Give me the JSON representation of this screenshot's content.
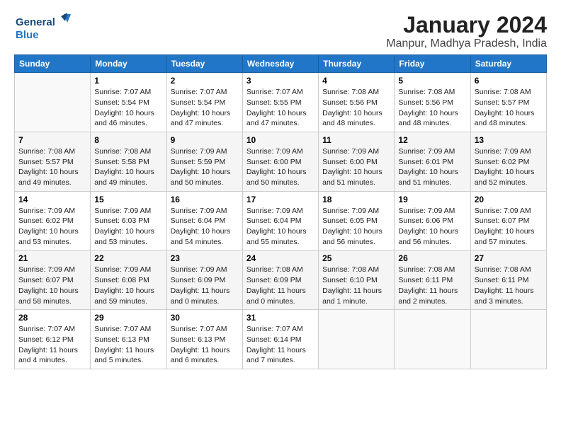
{
  "logo": {
    "line1": "General",
    "line2": "Blue"
  },
  "title": "January 2024",
  "subtitle": "Manpur, Madhya Pradesh, India",
  "days_header": [
    "Sunday",
    "Monday",
    "Tuesday",
    "Wednesday",
    "Thursday",
    "Friday",
    "Saturday"
  ],
  "weeks": [
    [
      {
        "day": "",
        "info": ""
      },
      {
        "day": "1",
        "info": "Sunrise: 7:07 AM\nSunset: 5:54 PM\nDaylight: 10 hours\nand 46 minutes."
      },
      {
        "day": "2",
        "info": "Sunrise: 7:07 AM\nSunset: 5:54 PM\nDaylight: 10 hours\nand 47 minutes."
      },
      {
        "day": "3",
        "info": "Sunrise: 7:07 AM\nSunset: 5:55 PM\nDaylight: 10 hours\nand 47 minutes."
      },
      {
        "day": "4",
        "info": "Sunrise: 7:08 AM\nSunset: 5:56 PM\nDaylight: 10 hours\nand 48 minutes."
      },
      {
        "day": "5",
        "info": "Sunrise: 7:08 AM\nSunset: 5:56 PM\nDaylight: 10 hours\nand 48 minutes."
      },
      {
        "day": "6",
        "info": "Sunrise: 7:08 AM\nSunset: 5:57 PM\nDaylight: 10 hours\nand 48 minutes."
      }
    ],
    [
      {
        "day": "7",
        "info": "Sunrise: 7:08 AM\nSunset: 5:57 PM\nDaylight: 10 hours\nand 49 minutes."
      },
      {
        "day": "8",
        "info": "Sunrise: 7:08 AM\nSunset: 5:58 PM\nDaylight: 10 hours\nand 49 minutes."
      },
      {
        "day": "9",
        "info": "Sunrise: 7:09 AM\nSunset: 5:59 PM\nDaylight: 10 hours\nand 50 minutes."
      },
      {
        "day": "10",
        "info": "Sunrise: 7:09 AM\nSunset: 6:00 PM\nDaylight: 10 hours\nand 50 minutes."
      },
      {
        "day": "11",
        "info": "Sunrise: 7:09 AM\nSunset: 6:00 PM\nDaylight: 10 hours\nand 51 minutes."
      },
      {
        "day": "12",
        "info": "Sunrise: 7:09 AM\nSunset: 6:01 PM\nDaylight: 10 hours\nand 51 minutes."
      },
      {
        "day": "13",
        "info": "Sunrise: 7:09 AM\nSunset: 6:02 PM\nDaylight: 10 hours\nand 52 minutes."
      }
    ],
    [
      {
        "day": "14",
        "info": "Sunrise: 7:09 AM\nSunset: 6:02 PM\nDaylight: 10 hours\nand 53 minutes."
      },
      {
        "day": "15",
        "info": "Sunrise: 7:09 AM\nSunset: 6:03 PM\nDaylight: 10 hours\nand 53 minutes."
      },
      {
        "day": "16",
        "info": "Sunrise: 7:09 AM\nSunset: 6:04 PM\nDaylight: 10 hours\nand 54 minutes."
      },
      {
        "day": "17",
        "info": "Sunrise: 7:09 AM\nSunset: 6:04 PM\nDaylight: 10 hours\nand 55 minutes."
      },
      {
        "day": "18",
        "info": "Sunrise: 7:09 AM\nSunset: 6:05 PM\nDaylight: 10 hours\nand 56 minutes."
      },
      {
        "day": "19",
        "info": "Sunrise: 7:09 AM\nSunset: 6:06 PM\nDaylight: 10 hours\nand 56 minutes."
      },
      {
        "day": "20",
        "info": "Sunrise: 7:09 AM\nSunset: 6:07 PM\nDaylight: 10 hours\nand 57 minutes."
      }
    ],
    [
      {
        "day": "21",
        "info": "Sunrise: 7:09 AM\nSunset: 6:07 PM\nDaylight: 10 hours\nand 58 minutes."
      },
      {
        "day": "22",
        "info": "Sunrise: 7:09 AM\nSunset: 6:08 PM\nDaylight: 10 hours\nand 59 minutes."
      },
      {
        "day": "23",
        "info": "Sunrise: 7:09 AM\nSunset: 6:09 PM\nDaylight: 11 hours\nand 0 minutes."
      },
      {
        "day": "24",
        "info": "Sunrise: 7:08 AM\nSunset: 6:09 PM\nDaylight: 11 hours\nand 0 minutes."
      },
      {
        "day": "25",
        "info": "Sunrise: 7:08 AM\nSunset: 6:10 PM\nDaylight: 11 hours\nand 1 minute."
      },
      {
        "day": "26",
        "info": "Sunrise: 7:08 AM\nSunset: 6:11 PM\nDaylight: 11 hours\nand 2 minutes."
      },
      {
        "day": "27",
        "info": "Sunrise: 7:08 AM\nSunset: 6:11 PM\nDaylight: 11 hours\nand 3 minutes."
      }
    ],
    [
      {
        "day": "28",
        "info": "Sunrise: 7:07 AM\nSunset: 6:12 PM\nDaylight: 11 hours\nand 4 minutes."
      },
      {
        "day": "29",
        "info": "Sunrise: 7:07 AM\nSunset: 6:13 PM\nDaylight: 11 hours\nand 5 minutes."
      },
      {
        "day": "30",
        "info": "Sunrise: 7:07 AM\nSunset: 6:13 PM\nDaylight: 11 hours\nand 6 minutes."
      },
      {
        "day": "31",
        "info": "Sunrise: 7:07 AM\nSunset: 6:14 PM\nDaylight: 11 hours\nand 7 minutes."
      },
      {
        "day": "",
        "info": ""
      },
      {
        "day": "",
        "info": ""
      },
      {
        "day": "",
        "info": ""
      }
    ]
  ]
}
